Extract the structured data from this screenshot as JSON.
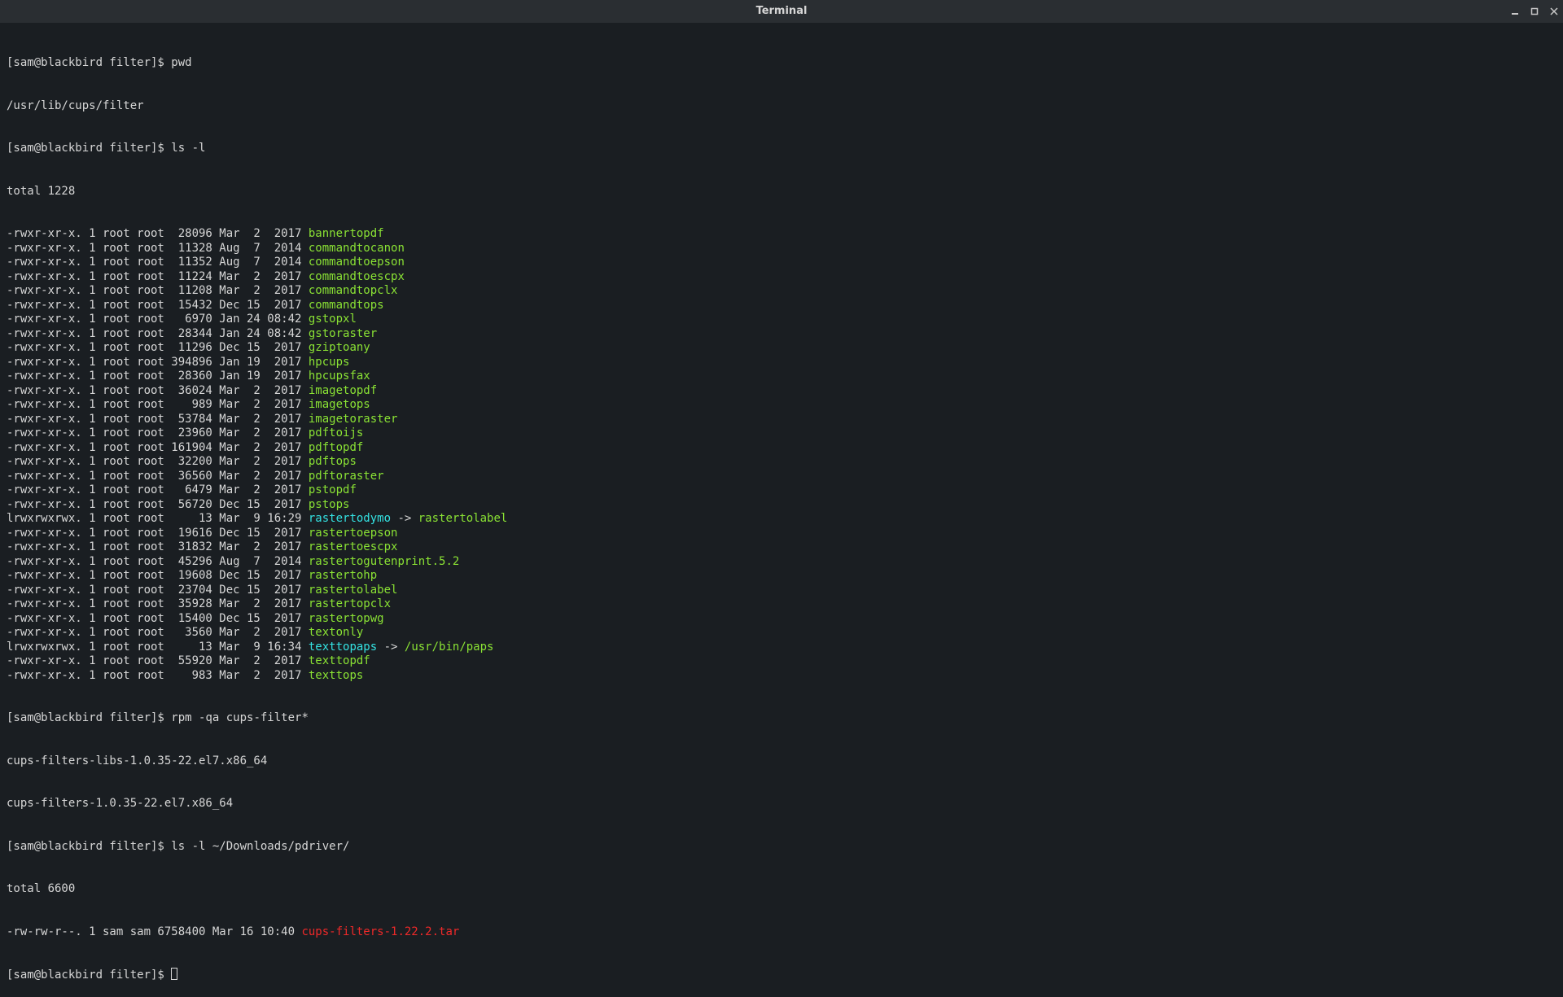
{
  "window": {
    "title": "Terminal"
  },
  "prompt": "[sam@blackbird filter]$ ",
  "cmd": {
    "pwd": "pwd",
    "pwd_out": "/usr/lib/cups/filter",
    "ls1": "ls -l",
    "ls1_total": "total 1228",
    "rpm": "rpm -qa cups-filter*",
    "rpm_out1": "cups-filters-libs-1.0.35-22.el7.x86_64",
    "rpm_out2": "cups-filters-1.0.35-22.el7.x86_64",
    "ls2": "ls -l ~/Downloads/pdriver/",
    "ls2_total": "total 6600"
  },
  "listing": [
    {
      "meta": "-rwxr-xr-x. 1 root root  28096 Mar  2  2017 ",
      "name": "bannertopdf",
      "color": "green"
    },
    {
      "meta": "-rwxr-xr-x. 1 root root  11328 Aug  7  2014 ",
      "name": "commandtocanon",
      "color": "green"
    },
    {
      "meta": "-rwxr-xr-x. 1 root root  11352 Aug  7  2014 ",
      "name": "commandtoepson",
      "color": "green"
    },
    {
      "meta": "-rwxr-xr-x. 1 root root  11224 Mar  2  2017 ",
      "name": "commandtoescpx",
      "color": "green"
    },
    {
      "meta": "-rwxr-xr-x. 1 root root  11208 Mar  2  2017 ",
      "name": "commandtopclx",
      "color": "green"
    },
    {
      "meta": "-rwxr-xr-x. 1 root root  15432 Dec 15  2017 ",
      "name": "commandtops",
      "color": "green"
    },
    {
      "meta": "-rwxr-xr-x. 1 root root   6970 Jan 24 08:42 ",
      "name": "gstopxl",
      "color": "green"
    },
    {
      "meta": "-rwxr-xr-x. 1 root root  28344 Jan 24 08:42 ",
      "name": "gstoraster",
      "color": "green"
    },
    {
      "meta": "-rwxr-xr-x. 1 root root  11296 Dec 15  2017 ",
      "name": "gziptoany",
      "color": "green"
    },
    {
      "meta": "-rwxr-xr-x. 1 root root 394896 Jan 19  2017 ",
      "name": "hpcups",
      "color": "green"
    },
    {
      "meta": "-rwxr-xr-x. 1 root root  28360 Jan 19  2017 ",
      "name": "hpcupsfax",
      "color": "green"
    },
    {
      "meta": "-rwxr-xr-x. 1 root root  36024 Mar  2  2017 ",
      "name": "imagetopdf",
      "color": "green"
    },
    {
      "meta": "-rwxr-xr-x. 1 root root    989 Mar  2  2017 ",
      "name": "imagetops",
      "color": "green"
    },
    {
      "meta": "-rwxr-xr-x. 1 root root  53784 Mar  2  2017 ",
      "name": "imagetoraster",
      "color": "green"
    },
    {
      "meta": "-rwxr-xr-x. 1 root root  23960 Mar  2  2017 ",
      "name": "pdftoijs",
      "color": "green"
    },
    {
      "meta": "-rwxr-xr-x. 1 root root 161904 Mar  2  2017 ",
      "name": "pdftopdf",
      "color": "green"
    },
    {
      "meta": "-rwxr-xr-x. 1 root root  32200 Mar  2  2017 ",
      "name": "pdftops",
      "color": "green"
    },
    {
      "meta": "-rwxr-xr-x. 1 root root  36560 Mar  2  2017 ",
      "name": "pdftoraster",
      "color": "green"
    },
    {
      "meta": "-rwxr-xr-x. 1 root root   6479 Mar  2  2017 ",
      "name": "pstopdf",
      "color": "green"
    },
    {
      "meta": "-rwxr-xr-x. 1 root root  56720 Dec 15  2017 ",
      "name": "pstops",
      "color": "green"
    },
    {
      "meta": "lrwxrwxrwx. 1 root root     13 Mar  9 16:29 ",
      "name": "rastertodymo",
      "color": "cyan",
      "arrow": " -> ",
      "target": "rastertolabel",
      "tcolor": "green"
    },
    {
      "meta": "-rwxr-xr-x. 1 root root  19616 Dec 15  2017 ",
      "name": "rastertoepson",
      "color": "green"
    },
    {
      "meta": "-rwxr-xr-x. 1 root root  31832 Mar  2  2017 ",
      "name": "rastertoescpx",
      "color": "green"
    },
    {
      "meta": "-rwxr-xr-x. 1 root root  45296 Aug  7  2014 ",
      "name": "rastertogutenprint.5.2",
      "color": "green"
    },
    {
      "meta": "-rwxr-xr-x. 1 root root  19608 Dec 15  2017 ",
      "name": "rastertohp",
      "color": "green"
    },
    {
      "meta": "-rwxr-xr-x. 1 root root  23704 Dec 15  2017 ",
      "name": "rastertolabel",
      "color": "green"
    },
    {
      "meta": "-rwxr-xr-x. 1 root root  35928 Mar  2  2017 ",
      "name": "rastertopclx",
      "color": "green"
    },
    {
      "meta": "-rwxr-xr-x. 1 root root  15400 Dec 15  2017 ",
      "name": "rastertopwg",
      "color": "green"
    },
    {
      "meta": "-rwxr-xr-x. 1 root root   3560 Mar  2  2017 ",
      "name": "textonly",
      "color": "green"
    },
    {
      "meta": "lrwxrwxrwx. 1 root root     13 Mar  9 16:34 ",
      "name": "texttopaps",
      "color": "cyan",
      "arrow": " -> ",
      "target": "/usr/bin/paps",
      "tcolor": "green"
    },
    {
      "meta": "-rwxr-xr-x. 1 root root  55920 Mar  2  2017 ",
      "name": "texttopdf",
      "color": "green"
    },
    {
      "meta": "-rwxr-xr-x. 1 root root    983 Mar  2  2017 ",
      "name": "texttops",
      "color": "green"
    }
  ],
  "downloads": {
    "meta": "-rw-rw-r--. 1 sam sam 6758400 Mar 16 10:40 ",
    "name": "cups-filters-1.22.2.tar",
    "color": "red"
  }
}
